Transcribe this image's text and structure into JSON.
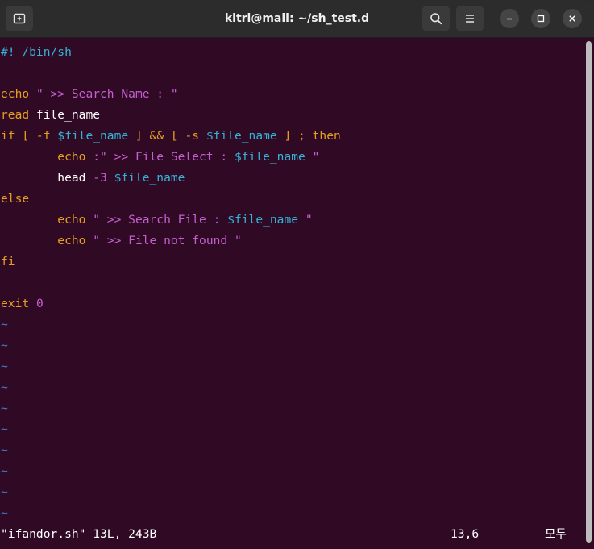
{
  "window": {
    "title": "kitri@mail: ~/sh_test.d"
  },
  "titlebar_icons": {
    "new_tab": "new-tab-icon",
    "search": "search-icon",
    "menu": "hamburger-menu-icon",
    "minimize": "minimize-icon",
    "maximize": "maximize-icon",
    "close": "close-icon"
  },
  "colors": {
    "background": "#300a24",
    "keyword": "#e59f20",
    "string": "#c45fd1",
    "variable": "#34b3d6",
    "tilde": "#3a7fd6"
  },
  "editor": {
    "lines": [
      [
        {
          "t": "#! /bin/sh",
          "c": "comment"
        }
      ],
      [],
      [
        {
          "t": "echo ",
          "c": "kw"
        },
        {
          "t": "\" >> Search Name : \"",
          "c": "str"
        }
      ],
      [
        {
          "t": "read ",
          "c": "kw"
        },
        {
          "t": "file_name",
          "c": "plain"
        }
      ],
      [
        {
          "t": "if [ -f ",
          "c": "kw"
        },
        {
          "t": "$file_name",
          "c": "var"
        },
        {
          "t": " ] && [ -s ",
          "c": "kw"
        },
        {
          "t": "$file_name",
          "c": "var"
        },
        {
          "t": " ] ; then",
          "c": "kw"
        }
      ],
      [
        {
          "t": "        echo ",
          "c": "kw"
        },
        {
          "t": ":\" >> File Select : ",
          "c": "str"
        },
        {
          "t": "$file_name",
          "c": "var"
        },
        {
          "t": " \"",
          "c": "str"
        }
      ],
      [
        {
          "t": "        head ",
          "c": "plain"
        },
        {
          "t": "-3 ",
          "c": "str"
        },
        {
          "t": "$file_name",
          "c": "var"
        }
      ],
      [
        {
          "t": "else",
          "c": "kw"
        }
      ],
      [
        {
          "t": "        echo ",
          "c": "kw"
        },
        {
          "t": "\" >> Search File : ",
          "c": "str"
        },
        {
          "t": "$file_name",
          "c": "var"
        },
        {
          "t": " \"",
          "c": "str"
        }
      ],
      [
        {
          "t": "        echo ",
          "c": "kw"
        },
        {
          "t": "\" >> File not found \"",
          "c": "str"
        }
      ],
      [
        {
          "t": "fi",
          "c": "kw"
        }
      ],
      [],
      [
        {
          "t": "exit ",
          "c": "kw"
        },
        {
          "t": "0",
          "c": "str"
        }
      ],
      [
        {
          "t": "~",
          "c": "tilde"
        }
      ],
      [
        {
          "t": "~",
          "c": "tilde"
        }
      ],
      [
        {
          "t": "~",
          "c": "tilde"
        }
      ],
      [
        {
          "t": "~",
          "c": "tilde"
        }
      ],
      [
        {
          "t": "~",
          "c": "tilde"
        }
      ],
      [
        {
          "t": "~",
          "c": "tilde"
        }
      ],
      [
        {
          "t": "~",
          "c": "tilde"
        }
      ],
      [
        {
          "t": "~",
          "c": "tilde"
        }
      ],
      [
        {
          "t": "~",
          "c": "tilde"
        }
      ],
      [
        {
          "t": "~",
          "c": "tilde"
        }
      ]
    ]
  },
  "status": {
    "file_info": "\"ifandor.sh\" 13L, 243B",
    "cursor": "13,6",
    "view": "모두"
  }
}
